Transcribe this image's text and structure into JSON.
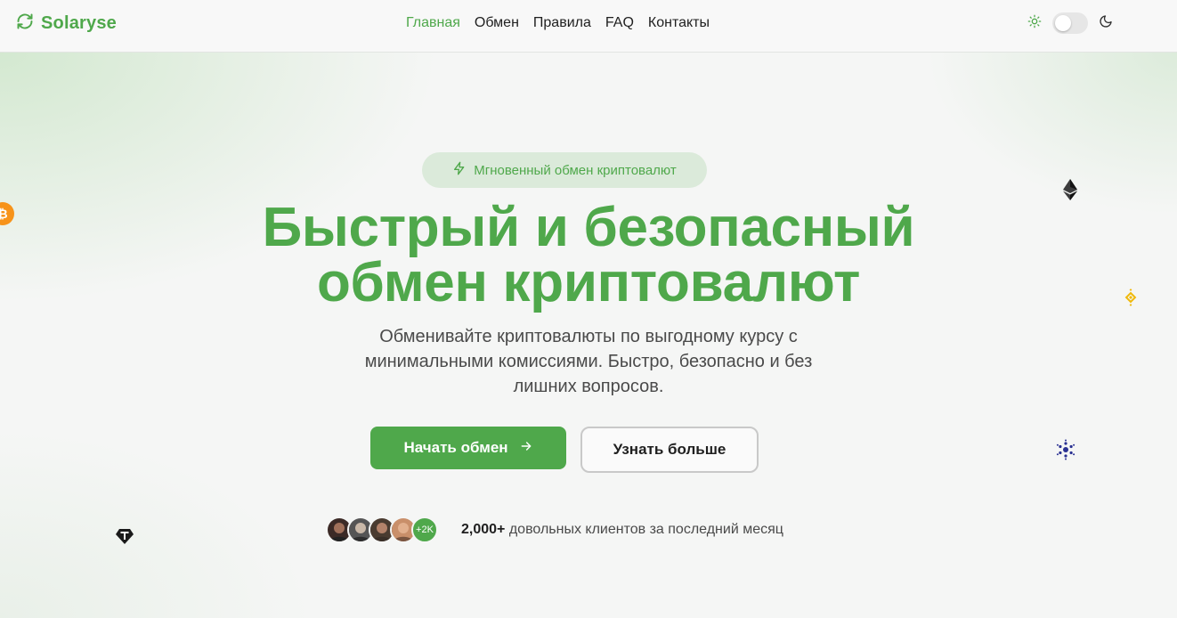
{
  "brand": {
    "name": "Solaryse"
  },
  "nav": {
    "items": [
      {
        "label": "Главная",
        "active": true
      },
      {
        "label": "Обмен",
        "active": false
      },
      {
        "label": "Правила",
        "active": false
      },
      {
        "label": "FAQ",
        "active": false
      },
      {
        "label": "Контакты",
        "active": false
      }
    ]
  },
  "theme_toggle": {
    "mode": "light",
    "icons": [
      "sun-icon",
      "moon-icon"
    ]
  },
  "hero": {
    "badge": "Мгновенный обмен криптовалют",
    "title_line1": "Быстрый и безопасный",
    "title_line2": "обмен криптовалют",
    "subtitle_line1": "Обменивайте криптовалюты по выгодному курсу с",
    "subtitle_line2": "минимальными комиссиями. Быстро, безопасно и без",
    "subtitle_line3": "лишних вопросов.",
    "primary_button": "Начать обмен",
    "secondary_button": "Узнать больше",
    "avatars_more": "+2K",
    "clients_count": "2,000+",
    "clients_text": "довольных клиентов за последний месяц"
  },
  "floating_coins": [
    "bitcoin-icon",
    "ethereum-icon",
    "binance-icon",
    "cardano-icon",
    "tether-icon"
  ],
  "colors": {
    "accent": "#4fa84b",
    "badge_bg": "#dbeada",
    "text": "#1f1f1f",
    "muted": "#4a4a4a",
    "bitcoin": "#f7931a",
    "binance": "#f0b90b",
    "cardano": "#2a3192"
  }
}
